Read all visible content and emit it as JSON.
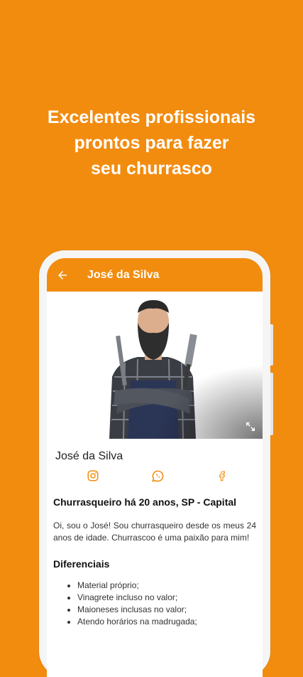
{
  "headline": [
    "Excelentes profissionais",
    "prontos para fazer",
    "seu churrasco"
  ],
  "appbar": {
    "title": "José da Silva"
  },
  "profile": {
    "name": "José da Silva",
    "subtitle": "Churrasqueiro há 20 anos, SP - Capital",
    "bio": "Oi, sou o José! Sou churrasqueiro desde os meus 24 anos de idade. Churrascoo é uma paixão para mim!",
    "section_title": "Diferenciais",
    "items": [
      "Material próprio;",
      "Vinagrete incluso no valor;",
      "Maioneses inclusas no valor;",
      "Atendo horários na madrugada;"
    ]
  },
  "icons": {
    "back": "arrow-left-icon",
    "expand": "expand-icon",
    "instagram": "instagram-icon",
    "whatsapp": "whatsapp-icon",
    "facebook": "facebook-icon"
  },
  "colors": {
    "brand": "#F28C0F",
    "text": "#222222"
  }
}
